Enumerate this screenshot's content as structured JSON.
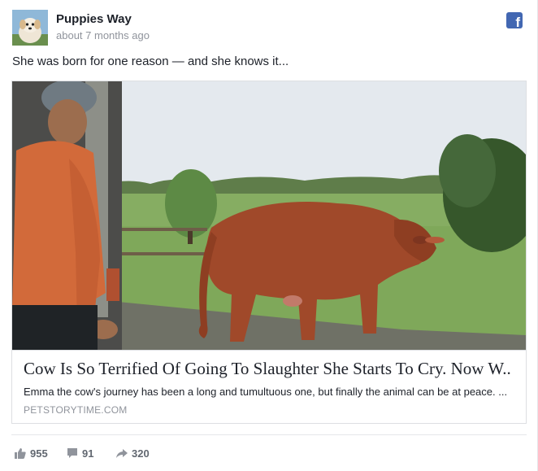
{
  "post": {
    "page_name": "Puppies Way",
    "timestamp": "about 7 months ago",
    "caption": "She was born for one reason — and she knows it..."
  },
  "link": {
    "headline": "Cow Is So Terrified Of Going To Slaughter She Starts To Cry. Now W..",
    "description": "Emma the cow's journey has been a long and tumultuous one, but finally the animal can be at peace. ...",
    "domain": "PETSTORYTIME.COM"
  },
  "stats": {
    "likes": "955",
    "comments": "91",
    "shares": "320"
  },
  "icons": {
    "brand": "facebook-icon",
    "like": "thumbs-up-icon",
    "comment": "speech-bubble-icon",
    "share": "share-arrow-icon"
  },
  "colors": {
    "brand": "#4267b2",
    "text": "#1d2129",
    "muted": "#90949c",
    "stats": "#616770"
  }
}
